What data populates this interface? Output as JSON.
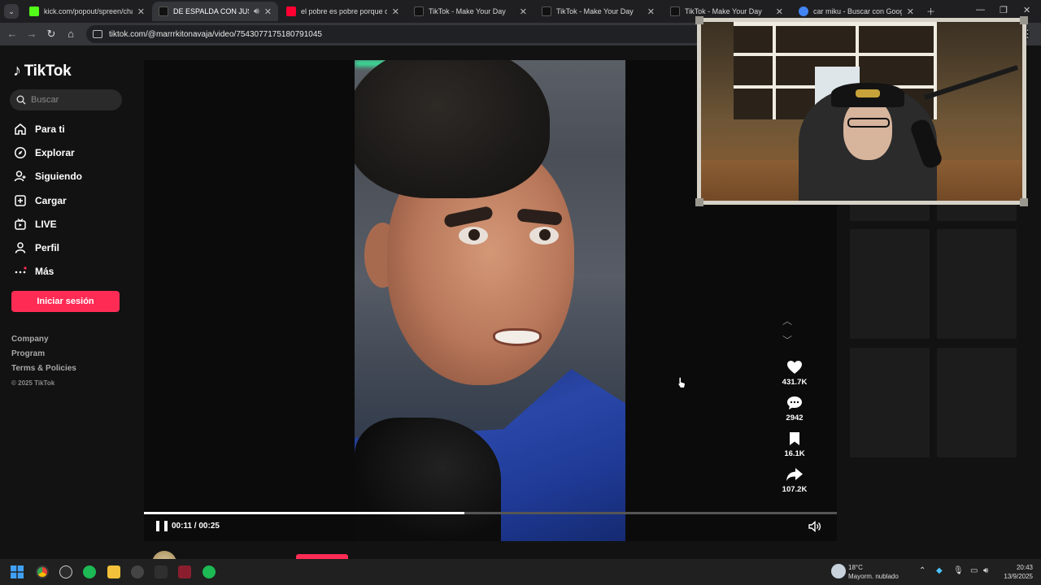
{
  "browser": {
    "tabs": [
      {
        "title": "kick.com/popout/spreen/chat",
        "favicon_color": "#53fc18",
        "active": false
      },
      {
        "title": "DE ESPALDA CON JUSTIN B",
        "favicon_color": "#111111",
        "active": true
      },
      {
        "title": "el pobre es pobre porque quie",
        "favicon_color": "#ff0033",
        "active": false
      },
      {
        "title": "TikTok - Make Your Day",
        "favicon_color": "#111111",
        "active": false
      },
      {
        "title": "TikTok - Make Your Day",
        "favicon_color": "#111111",
        "active": false
      },
      {
        "title": "TikTok - Make Your Day",
        "favicon_color": "#111111",
        "active": false
      },
      {
        "title": "car miku - Buscar con Google",
        "favicon_color": "#4285f4",
        "active": false
      }
    ],
    "url": "tiktok.com/@marrrkitonavaja/video/7543077175180791045",
    "icons": [
      "back-icon",
      "forward-icon",
      "reload-icon",
      "home-icon",
      "site-info-icon",
      "menu-icon"
    ]
  },
  "sidebar": {
    "logo_text": "TikTok",
    "search_placeholder": "Buscar",
    "items": [
      {
        "label": "Para ti",
        "icon": "home-icon"
      },
      {
        "label": "Explorar",
        "icon": "compass-icon"
      },
      {
        "label": "Siguiendo",
        "icon": "user-plus-icon"
      },
      {
        "label": "Cargar",
        "icon": "upload-icon"
      },
      {
        "label": "LIVE",
        "icon": "live-icon"
      },
      {
        "label": "Perfil",
        "icon": "profile-icon"
      },
      {
        "label": "Más",
        "icon": "more-icon"
      }
    ],
    "login_label": "Iniciar sesión",
    "footer": [
      "Company",
      "Program",
      "Terms & Policies"
    ],
    "copyright": "© 2025 TikTok"
  },
  "video": {
    "time_display": "00:11 / 00:25",
    "progress_fraction": 0.44,
    "likes": "431.7K",
    "comments": "2942",
    "saves": "16.1K",
    "shares": "107.2K",
    "author_name": "marrrkitonavaja",
    "accent": "#fe2c55"
  },
  "taskbar": {
    "temperature": "18°C",
    "weather_text": "Mayorm. nublado",
    "time": "20:43",
    "date": "13/9/2025"
  }
}
